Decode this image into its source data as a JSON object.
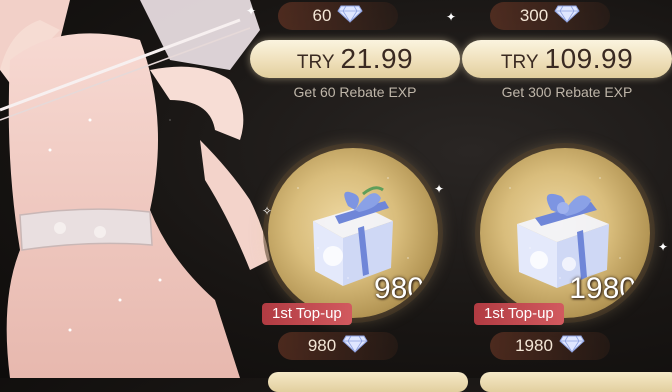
{
  "packs": [
    {
      "amount_top": "60",
      "price_currency": "TRY",
      "price_value": "21.99",
      "rebate": "Get 60 Rebate EXP",
      "gift_qty": "980",
      "badge": "1st Top-up",
      "amount_bottom": "980"
    },
    {
      "amount_top": "300",
      "price_currency": "TRY",
      "price_value": "109.99",
      "rebate": "Get 300 Rebate EXP",
      "gift_qty": "1980",
      "badge": "1st Top-up",
      "amount_bottom": "1980"
    }
  ],
  "icons": {
    "currency": "diamond-icon"
  },
  "colors": {
    "price_button": "#f1e2bd",
    "badge": "#c2484e",
    "circle": "#d9bd7c"
  }
}
